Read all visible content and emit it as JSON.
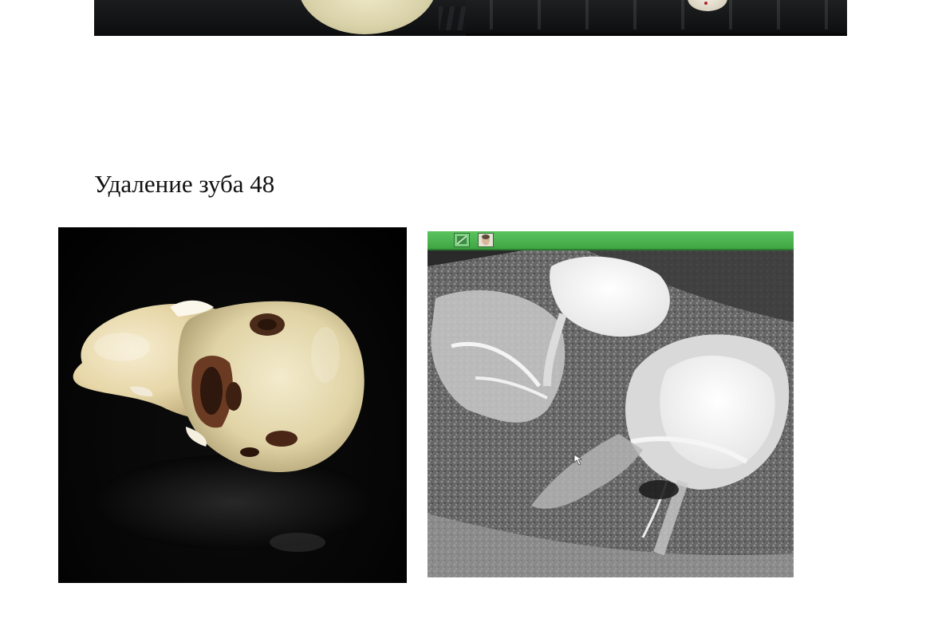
{
  "page": {
    "title": "Удаление зуба 48"
  },
  "icons": {
    "xray_toolbar_buttons": [
      "contrast-icon",
      "patient-face-icon"
    ]
  },
  "colors": {
    "xray_toolbar": "#4cb650",
    "background": "#ffffff",
    "photo_background": "#000000"
  }
}
